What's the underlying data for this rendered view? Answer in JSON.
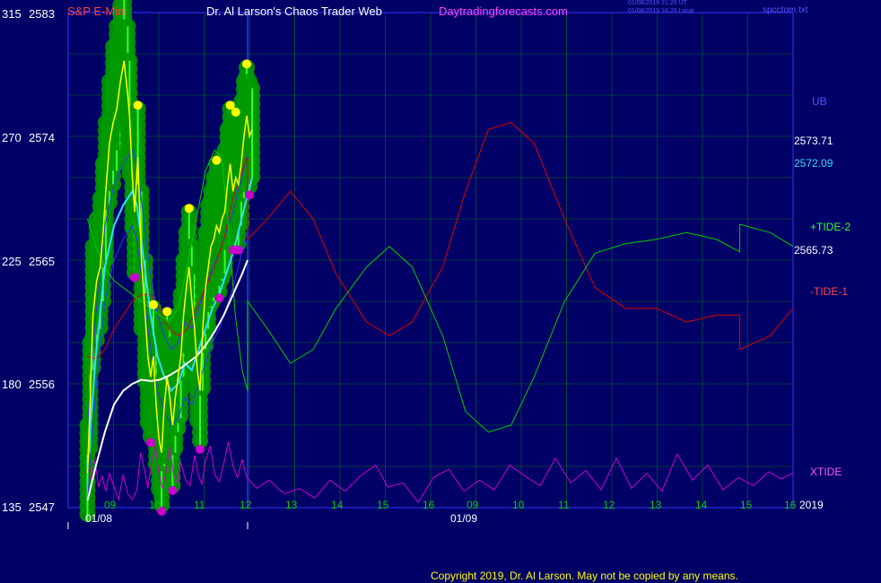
{
  "header": {
    "instrument": "S&P E-Mini",
    "title": "Dr. Al Larson's Chaos Trader Web",
    "site": "Daytradingforecasts.com",
    "stamp_ut": "01/08/2019 21:20 UT",
    "stamp_local": "01/08/2019 16:20 Local",
    "file": "spcctom.txt"
  },
  "footer": {
    "copyright": "Copyright 2019, Dr. Al Larson. May not be copied by any means."
  },
  "colors": {
    "background": "#000066",
    "grid": "#00a000",
    "price": "#ffff00",
    "band_fill": "#009900",
    "sma_fast": "#33ddff",
    "sma_slow": "#ffffff",
    "tide_plus": "#00cc00",
    "tide_minus": "#dd0000",
    "xtide": "#cc00cc",
    "cycle_blue": "#3333ff",
    "divider": "#3333ff"
  },
  "chart_data": {
    "type": "line",
    "y_right": {
      "min": 2547,
      "max": 2583
    },
    "y_left_ticks": [
      {
        "angle": "315",
        "price": "2583"
      },
      {
        "angle": "270",
        "price": "2574"
      },
      {
        "angle": "225",
        "price": "2565"
      },
      {
        "angle": "180",
        "price": "2556"
      },
      {
        "angle": "135",
        "price": "2547"
      }
    ],
    "x_ticks_day1": [
      "09",
      "10",
      "11",
      "12",
      "13",
      "14",
      "15",
      "16"
    ],
    "x_ticks_day2": [
      "09",
      "10",
      "11",
      "12",
      "13",
      "14",
      "15",
      "16"
    ],
    "date_labels": [
      "01/08",
      "01/09"
    ],
    "year": "2019",
    "right_labels": {
      "ub": "UB",
      "v1": "2573.71",
      "v2": "2572.09",
      "tide_plus": "+TIDE-2",
      "v3": "2565.73",
      "tide_minus": "-TIDE-1",
      "xtide": "XTIDE"
    },
    "x_range": [
      8.5,
      17.0
    ],
    "price_close_path": [
      [
        8.52,
        2549.5
      ],
      [
        8.58,
        2555
      ],
      [
        8.64,
        2561
      ],
      [
        8.72,
        2563.5
      ],
      [
        8.8,
        2564.5
      ],
      [
        8.86,
        2567
      ],
      [
        8.92,
        2570
      ],
      [
        9.0,
        2573.5
      ],
      [
        9.08,
        2575
      ],
      [
        9.16,
        2576
      ],
      [
        9.24,
        2578
      ],
      [
        9.32,
        2579.5
      ],
      [
        9.4,
        2577
      ],
      [
        9.44,
        2575.5
      ],
      [
        9.5,
        2571
      ],
      [
        9.55,
        2568.5
      ],
      [
        9.62,
        2572.5
      ],
      [
        9.7,
        2565
      ],
      [
        9.78,
        2561
      ],
      [
        9.84,
        2558
      ],
      [
        9.9,
        2556.5
      ],
      [
        9.96,
        2558
      ],
      [
        10.02,
        2554.5
      ],
      [
        10.08,
        2552
      ],
      [
        10.14,
        2551
      ],
      [
        10.2,
        2554.5
      ],
      [
        10.26,
        2556.5
      ],
      [
        10.32,
        2555
      ],
      [
        10.38,
        2553
      ],
      [
        10.44,
        2555
      ],
      [
        10.5,
        2556.5
      ],
      [
        10.56,
        2558
      ],
      [
        10.62,
        2561
      ],
      [
        10.68,
        2563
      ],
      [
        10.74,
        2564.5
      ],
      [
        10.8,
        2562
      ],
      [
        10.86,
        2560
      ],
      [
        10.92,
        2557
      ],
      [
        10.98,
        2555.5
      ],
      [
        11.04,
        2560
      ],
      [
        11.1,
        2563
      ],
      [
        11.16,
        2564.5
      ],
      [
        11.22,
        2566
      ],
      [
        11.28,
        2566.5
      ],
      [
        11.34,
        2567.5
      ],
      [
        11.4,
        2567
      ],
      [
        11.46,
        2568
      ],
      [
        11.52,
        2568.5
      ],
      [
        11.58,
        2570.5
      ],
      [
        11.64,
        2572
      ],
      [
        11.7,
        2570
      ],
      [
        11.76,
        2571
      ],
      [
        11.82,
        2570.5
      ],
      [
        11.88,
        2572
      ],
      [
        11.94,
        2574
      ],
      [
        12.0,
        2575.5
      ],
      [
        12.06,
        2574
      ],
      [
        12.12,
        2574.5
      ]
    ],
    "price_high_path": [
      [
        8.52,
        2553
      ],
      [
        8.58,
        2559
      ],
      [
        8.64,
        2566
      ],
      [
        8.72,
        2568
      ],
      [
        8.8,
        2569.5
      ],
      [
        8.86,
        2572
      ],
      [
        8.92,
        2575
      ],
      [
        9.0,
        2578
      ],
      [
        9.08,
        2580.5
      ],
      [
        9.16,
        2582
      ],
      [
        9.24,
        2583.5
      ],
      [
        9.32,
        2585
      ],
      [
        9.4,
        2582
      ],
      [
        9.44,
        2579.5
      ],
      [
        9.5,
        2575
      ],
      [
        9.55,
        2573.5
      ],
      [
        9.62,
        2576
      ],
      [
        9.7,
        2570
      ],
      [
        9.78,
        2565
      ],
      [
        9.84,
        2562
      ],
      [
        9.9,
        2561
      ],
      [
        9.96,
        2561.5
      ],
      [
        10.02,
        2559
      ],
      [
        10.08,
        2556
      ],
      [
        10.14,
        2556
      ],
      [
        10.2,
        2559
      ],
      [
        10.26,
        2561
      ],
      [
        10.32,
        2560
      ],
      [
        10.38,
        2558
      ],
      [
        10.44,
        2559
      ],
      [
        10.5,
        2561
      ],
      [
        10.56,
        2562.5
      ],
      [
        10.62,
        2565
      ],
      [
        10.68,
        2567
      ],
      [
        10.74,
        2568.5
      ],
      [
        10.8,
        2566
      ],
      [
        10.86,
        2564
      ],
      [
        10.92,
        2561
      ],
      [
        10.98,
        2559.5
      ],
      [
        11.04,
        2564.5
      ],
      [
        11.1,
        2567
      ],
      [
        11.16,
        2569
      ],
      [
        11.22,
        2570
      ],
      [
        11.28,
        2571
      ],
      [
        11.34,
        2572
      ],
      [
        11.4,
        2571.5
      ],
      [
        11.46,
        2572.5
      ],
      [
        11.52,
        2573
      ],
      [
        11.58,
        2574.5
      ],
      [
        11.64,
        2576
      ],
      [
        11.7,
        2574.5
      ],
      [
        11.76,
        2575.5
      ],
      [
        11.82,
        2575
      ],
      [
        11.88,
        2576.5
      ],
      [
        11.94,
        2578
      ],
      [
        12.0,
        2579
      ],
      [
        12.06,
        2578
      ],
      [
        12.12,
        2577.5
      ]
    ],
    "price_low_path": [
      [
        8.52,
        2546
      ],
      [
        8.58,
        2551
      ],
      [
        8.64,
        2557
      ],
      [
        8.72,
        2559
      ],
      [
        8.8,
        2560
      ],
      [
        8.86,
        2562
      ],
      [
        8.92,
        2565
      ],
      [
        9.0,
        2569
      ],
      [
        9.08,
        2570.5
      ],
      [
        9.16,
        2571.5
      ],
      [
        9.24,
        2573
      ],
      [
        9.32,
        2575
      ],
      [
        9.4,
        2573
      ],
      [
        9.44,
        2571
      ],
      [
        9.5,
        2567
      ],
      [
        9.55,
        2564
      ],
      [
        9.62,
        2568
      ],
      [
        9.7,
        2560
      ],
      [
        9.78,
        2556
      ],
      [
        9.84,
        2553
      ],
      [
        9.9,
        2552
      ],
      [
        9.96,
        2553.5
      ],
      [
        10.02,
        2550
      ],
      [
        10.08,
        2548
      ],
      [
        10.14,
        2547
      ],
      [
        10.2,
        2550
      ],
      [
        10.26,
        2552.5
      ],
      [
        10.32,
        2550.5
      ],
      [
        10.38,
        2548.5
      ],
      [
        10.44,
        2551
      ],
      [
        10.5,
        2552.5
      ],
      [
        10.56,
        2553.5
      ],
      [
        10.62,
        2556.5
      ],
      [
        10.68,
        2558.5
      ],
      [
        10.74,
        2560
      ],
      [
        10.8,
        2557.5
      ],
      [
        10.86,
        2555.5
      ],
      [
        10.92,
        2553
      ],
      [
        10.98,
        2551.5
      ],
      [
        11.04,
        2555.5
      ],
      [
        11.1,
        2558.5
      ],
      [
        11.16,
        2560
      ],
      [
        11.22,
        2561.5
      ],
      [
        11.28,
        2562
      ],
      [
        11.34,
        2563
      ],
      [
        11.4,
        2562.5
      ],
      [
        11.46,
        2563.5
      ],
      [
        11.52,
        2564
      ],
      [
        11.58,
        2566
      ],
      [
        11.64,
        2567.5
      ],
      [
        11.7,
        2566
      ],
      [
        11.76,
        2567
      ],
      [
        11.82,
        2566
      ],
      [
        11.88,
        2567.5
      ],
      [
        11.94,
        2569.5
      ],
      [
        12.0,
        2571
      ],
      [
        12.06,
        2570
      ],
      [
        12.12,
        2571
      ]
    ],
    "sma_fast": [
      [
        8.52,
        2550
      ],
      [
        8.7,
        2558
      ],
      [
        8.9,
        2564.5
      ],
      [
        9.1,
        2567.5
      ],
      [
        9.3,
        2569
      ],
      [
        9.5,
        2570
      ],
      [
        9.6,
        2569
      ],
      [
        9.75,
        2565
      ],
      [
        9.9,
        2561
      ],
      [
        10.05,
        2558
      ],
      [
        10.2,
        2556.5
      ],
      [
        10.35,
        2555.5
      ],
      [
        10.5,
        2556
      ],
      [
        10.65,
        2557.5
      ],
      [
        10.8,
        2557
      ],
      [
        10.95,
        2558.5
      ],
      [
        11.1,
        2560
      ],
      [
        11.25,
        2561.5
      ],
      [
        11.4,
        2562.5
      ],
      [
        11.55,
        2564
      ],
      [
        11.7,
        2565.5
      ],
      [
        11.85,
        2567.5
      ],
      [
        12.0,
        2569.5
      ],
      [
        12.12,
        2571
      ]
    ],
    "sma_slow": [
      [
        8.52,
        2547.5
      ],
      [
        8.7,
        2550
      ],
      [
        8.9,
        2552.5
      ],
      [
        9.1,
        2554.5
      ],
      [
        9.3,
        2555.5
      ],
      [
        9.5,
        2556
      ],
      [
        9.7,
        2556.3
      ],
      [
        9.9,
        2556.2
      ],
      [
        10.1,
        2556.3
      ],
      [
        10.3,
        2556.6
      ],
      [
        10.5,
        2557
      ],
      [
        10.7,
        2557.5
      ],
      [
        10.9,
        2558
      ],
      [
        11.1,
        2558.8
      ],
      [
        11.3,
        2559.8
      ],
      [
        11.5,
        2561
      ],
      [
        11.7,
        2562.5
      ],
      [
        11.9,
        2564
      ],
      [
        12.02,
        2565
      ]
    ],
    "tide_minus": [
      [
        8.52,
        2558
      ],
      [
        8.7,
        2557.8
      ],
      [
        8.9,
        2558.5
      ],
      [
        9.1,
        2560
      ],
      [
        9.3,
        2561
      ],
      [
        9.5,
        2562
      ],
      [
        9.7,
        2562.5
      ],
      [
        9.9,
        2562.5
      ],
      [
        10.1,
        2561.5
      ],
      [
        10.3,
        2560
      ],
      [
        10.5,
        2559.5
      ],
      [
        10.7,
        2560
      ],
      [
        10.9,
        2561.5
      ],
      [
        11.1,
        2563
      ],
      [
        11.3,
        2564.5
      ],
      [
        11.5,
        2566.5
      ],
      [
        11.7,
        2569.5
      ],
      [
        11.9,
        2571.5
      ],
      [
        12.02,
        2572.5
      ],
      [
        12.02,
        2566.5
      ],
      [
        12.15,
        2568
      ],
      [
        12.3,
        2570
      ],
      [
        12.45,
        2568
      ],
      [
        12.6,
        2564
      ],
      [
        12.8,
        2560.5
      ],
      [
        12.95,
        2559.5
      ],
      [
        13.1,
        2560.5
      ],
      [
        13.3,
        2564.5
      ],
      [
        13.45,
        2570
      ],
      [
        13.6,
        2574.5
      ],
      [
        13.75,
        2575
      ],
      [
        13.9,
        2573.5
      ],
      [
        14.1,
        2568
      ],
      [
        14.3,
        2563
      ],
      [
        14.5,
        2561.5
      ],
      [
        14.7,
        2561.5
      ],
      [
        14.9,
        2560.5
      ],
      [
        15.1,
        2561
      ],
      [
        15.25,
        2561
      ],
      [
        15.25,
        2558.5
      ],
      [
        15.45,
        2559.5
      ],
      [
        15.6,
        2561.5
      ]
    ],
    "tide_plus": [
      [
        8.52,
        2568
      ],
      [
        8.7,
        2566
      ],
      [
        8.9,
        2564.5
      ],
      [
        9.1,
        2563.5
      ],
      [
        9.3,
        2563
      ],
      [
        9.5,
        2562.5
      ],
      [
        9.7,
        2562
      ],
      [
        9.9,
        2561.5
      ],
      [
        10.1,
        2561
      ],
      [
        10.3,
        2560.5
      ],
      [
        10.5,
        2561.5
      ],
      [
        10.7,
        2564.5
      ],
      [
        10.9,
        2568
      ],
      [
        11.1,
        2571.5
      ],
      [
        11.3,
        2573
      ],
      [
        11.45,
        2572.5
      ],
      [
        11.6,
        2567.5
      ],
      [
        11.75,
        2561
      ],
      [
        11.9,
        2557
      ],
      [
        12.02,
        2555.5
      ],
      [
        12.02,
        2562
      ],
      [
        12.15,
        2560
      ],
      [
        12.3,
        2557.5
      ],
      [
        12.45,
        2558.5
      ],
      [
        12.6,
        2561.5
      ],
      [
        12.8,
        2564.5
      ],
      [
        12.95,
        2566
      ],
      [
        13.1,
        2564.5
      ],
      [
        13.3,
        2559.5
      ],
      [
        13.45,
        2554
      ],
      [
        13.6,
        2552.5
      ],
      [
        13.75,
        2553
      ],
      [
        13.9,
        2556.5
      ],
      [
        14.1,
        2562
      ],
      [
        14.3,
        2565.5
      ],
      [
        14.5,
        2566.2
      ],
      [
        14.7,
        2566.5
      ],
      [
        14.9,
        2567
      ],
      [
        15.1,
        2566.5
      ],
      [
        15.25,
        2565.6
      ],
      [
        15.25,
        2567.6
      ],
      [
        15.45,
        2567
      ],
      [
        15.6,
        2566
      ]
    ],
    "xtide": [
      [
        8.52,
        2550
      ],
      [
        8.6,
        2549
      ],
      [
        8.68,
        2550.5
      ],
      [
        8.76,
        2548.5
      ],
      [
        8.84,
        2549.3
      ],
      [
        8.92,
        2548.2
      ],
      [
        9.0,
        2549.5
      ],
      [
        9.1,
        2548.5
      ],
      [
        9.2,
        2547.6
      ],
      [
        9.3,
        2549.4
      ],
      [
        9.4,
        2548
      ],
      [
        9.5,
        2547.6
      ],
      [
        9.6,
        2548.3
      ],
      [
        9.68,
        2551
      ],
      [
        9.76,
        2549.8
      ],
      [
        9.84,
        2548.4
      ],
      [
        9.92,
        2550.2
      ],
      [
        10.0,
        2551.6
      ],
      [
        10.08,
        2549.5
      ],
      [
        10.16,
        2548.4
      ],
      [
        10.24,
        2549.6
      ],
      [
        10.32,
        2551.4
      ],
      [
        10.4,
        2549.4
      ],
      [
        10.48,
        2548.8
      ],
      [
        10.56,
        2550.3
      ],
      [
        10.66,
        2549
      ],
      [
        10.76,
        2548.6
      ],
      [
        10.86,
        2550.8
      ],
      [
        10.94,
        2549.4
      ],
      [
        11.02,
        2548.7
      ],
      [
        11.1,
        2550.4
      ],
      [
        11.2,
        2551.5
      ],
      [
        11.3,
        2549.4
      ],
      [
        11.4,
        2548.9
      ],
      [
        11.5,
        2550.2
      ],
      [
        11.6,
        2551.8
      ],
      [
        11.7,
        2550
      ],
      [
        11.8,
        2549.2
      ],
      [
        11.9,
        2550.5
      ],
      [
        12.0,
        2549.2
      ],
      [
        12.08,
        2548.4
      ],
      [
        12.16,
        2549
      ],
      [
        12.26,
        2548
      ],
      [
        12.36,
        2548.4
      ],
      [
        12.46,
        2547.7
      ],
      [
        12.56,
        2549
      ],
      [
        12.66,
        2548.2
      ],
      [
        12.76,
        2549.3
      ],
      [
        12.86,
        2550.1
      ],
      [
        12.94,
        2548.5
      ],
      [
        13.04,
        2548.8
      ],
      [
        13.14,
        2547.4
      ],
      [
        13.24,
        2549.2
      ],
      [
        13.34,
        2549.8
      ],
      [
        13.44,
        2548.2
      ],
      [
        13.54,
        2549
      ],
      [
        13.64,
        2548.3
      ],
      [
        13.74,
        2550.1
      ],
      [
        13.84,
        2549.3
      ],
      [
        13.94,
        2548.6
      ],
      [
        14.04,
        2550.6
      ],
      [
        14.14,
        2548.8
      ],
      [
        14.24,
        2549.7
      ],
      [
        14.34,
        2548.3
      ],
      [
        14.44,
        2550.6
      ],
      [
        14.54,
        2548.4
      ],
      [
        14.64,
        2549.5
      ],
      [
        14.74,
        2548.2
      ],
      [
        14.84,
        2550.9
      ],
      [
        14.94,
        2549
      ],
      [
        15.04,
        2550.1
      ],
      [
        15.14,
        2548.3
      ],
      [
        15.24,
        2549.2
      ],
      [
        15.34,
        2548.6
      ],
      [
        15.44,
        2549.6
      ],
      [
        15.52,
        2549.1
      ],
      [
        15.6,
        2549.5
      ]
    ],
    "divider_x": 12.02,
    "end_x": 15.6
  }
}
